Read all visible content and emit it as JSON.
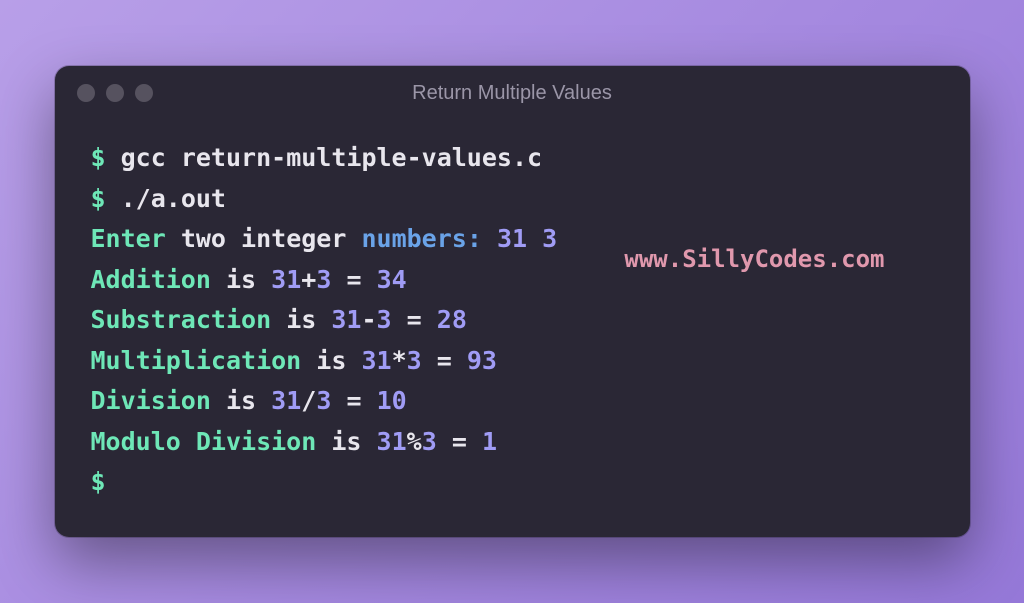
{
  "window": {
    "title": "Return Multiple Values"
  },
  "watermark": "www.SillyCodes.com",
  "terminal": {
    "prompt": "$",
    "commands": {
      "compile": "gcc return-multiple-values.c",
      "run": "./a.out"
    },
    "input_prompt": {
      "word1": "Enter",
      "word2": "two",
      "word3": "integer",
      "word4": "numbers:",
      "val1": "31",
      "val2": "3"
    },
    "results": {
      "addition": {
        "label": "Addition",
        "is": "is",
        "a": "31",
        "op": "+",
        "b": "3",
        "eq": "=",
        "r": "34"
      },
      "subtraction": {
        "label": "Substraction",
        "is": "is",
        "a": "31",
        "op": "-",
        "b": "3",
        "eq": "=",
        "r": "28"
      },
      "multiplication": {
        "label": "Multiplication",
        "is": "is",
        "a": "31",
        "op": "*",
        "b": "3",
        "eq": "=",
        "r": "93"
      },
      "division": {
        "label": "Division",
        "is": "is",
        "a": "31",
        "op": "/",
        "b": "3",
        "eq": "=",
        "r": "10"
      },
      "modulo": {
        "label": "Modulo Division",
        "is": "is",
        "a": "31",
        "op": "%",
        "b": "3",
        "eq": "=",
        "r": "1"
      }
    }
  }
}
